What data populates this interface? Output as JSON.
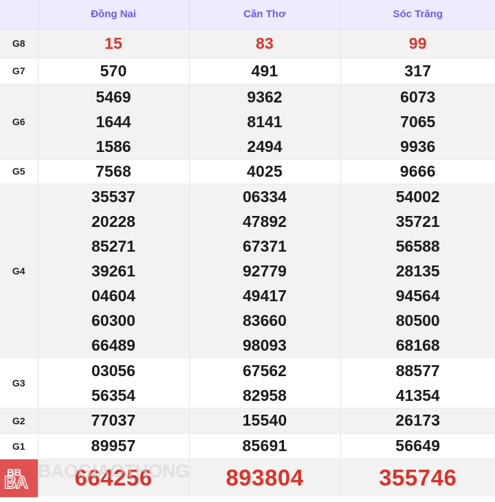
{
  "table": {
    "header": {
      "blank_label": "",
      "provinces": [
        "Đồng Nai",
        "Cần Thơ",
        "Sóc Trăng"
      ]
    },
    "prize_rows": [
      {
        "label": "G8",
        "style": "shade",
        "color": "red",
        "values": [
          [
            "15"
          ],
          [
            "83"
          ],
          [
            "99"
          ]
        ]
      },
      {
        "label": "G7",
        "style": "plain",
        "color": "black",
        "values": [
          [
            "570"
          ],
          [
            "491"
          ],
          [
            "317"
          ]
        ]
      },
      {
        "label": "G6",
        "style": "shade",
        "color": "black",
        "values": [
          [
            "5469",
            "1644",
            "1586"
          ],
          [
            "9362",
            "8141",
            "2494"
          ],
          [
            "6073",
            "7065",
            "9936"
          ]
        ]
      },
      {
        "label": "G5",
        "style": "plain",
        "color": "black",
        "values": [
          [
            "7568"
          ],
          [
            "4025"
          ],
          [
            "9666"
          ]
        ]
      },
      {
        "label": "G4",
        "style": "shade",
        "color": "black",
        "values": [
          [
            "35537",
            "20228",
            "85271",
            "39261",
            "04604",
            "60300",
            "66489"
          ],
          [
            "06334",
            "47892",
            "67371",
            "92779",
            "49417",
            "83660",
            "98093"
          ],
          [
            "54002",
            "35721",
            "56588",
            "28135",
            "94564",
            "80500",
            "68168"
          ]
        ]
      },
      {
        "label": "G3",
        "style": "plain",
        "color": "black",
        "values": [
          [
            "03056",
            "56354"
          ],
          [
            "67562",
            "82958"
          ],
          [
            "88577",
            "41354"
          ]
        ]
      },
      {
        "label": "G2",
        "style": "shade",
        "color": "black",
        "values": [
          [
            "77037"
          ],
          [
            "15540"
          ],
          [
            "26173"
          ]
        ]
      },
      {
        "label": "G1",
        "style": "plain",
        "color": "black",
        "values": [
          [
            "89957"
          ],
          [
            "85691"
          ],
          [
            "56649"
          ]
        ]
      }
    ],
    "special_row": {
      "label": "",
      "values": [
        "664256",
        "893804",
        "355746"
      ]
    }
  },
  "watermark": {
    "badge_top": "BB",
    "badge_bottom": "BA",
    "ghost_text": "BAOGIAOTHONG"
  },
  "colors": {
    "header_bg": "#eeeaff",
    "header_text": "#6c5ce7",
    "prize_red": "#d9342b",
    "row_shade": "#f2f2f2",
    "row_plain": "#ffffff",
    "watermark_badge": "#e05252"
  }
}
